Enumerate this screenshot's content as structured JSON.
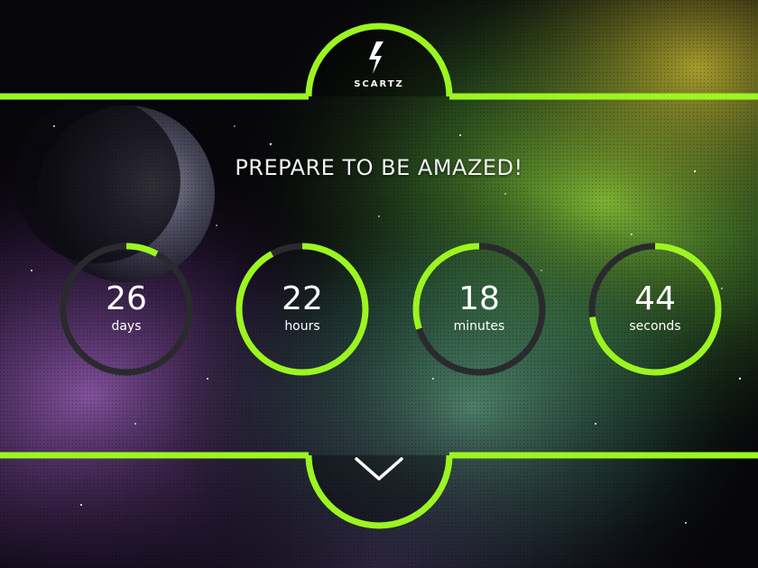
{
  "brand": {
    "name": "SCARTZ",
    "logo_icon": "lightning-bolt-icon"
  },
  "headline": "PREPARE TO BE AMAZED!",
  "countdown": [
    {
      "value": "26",
      "label": "days",
      "progress": 0.08,
      "start": 0.0
    },
    {
      "value": "22",
      "label": "hours",
      "progress": 0.92,
      "start": 0.0
    },
    {
      "value": "18",
      "label": "minutes",
      "progress": 0.3,
      "start": 0.7
    },
    {
      "value": "44",
      "label": "seconds",
      "progress": 0.73,
      "start": 0.0
    }
  ],
  "scroll_icon": "chevron-down-icon",
  "colors": {
    "accent": "#9cf520",
    "ring_track": "#2a2a2e",
    "text": "#ffffff"
  }
}
